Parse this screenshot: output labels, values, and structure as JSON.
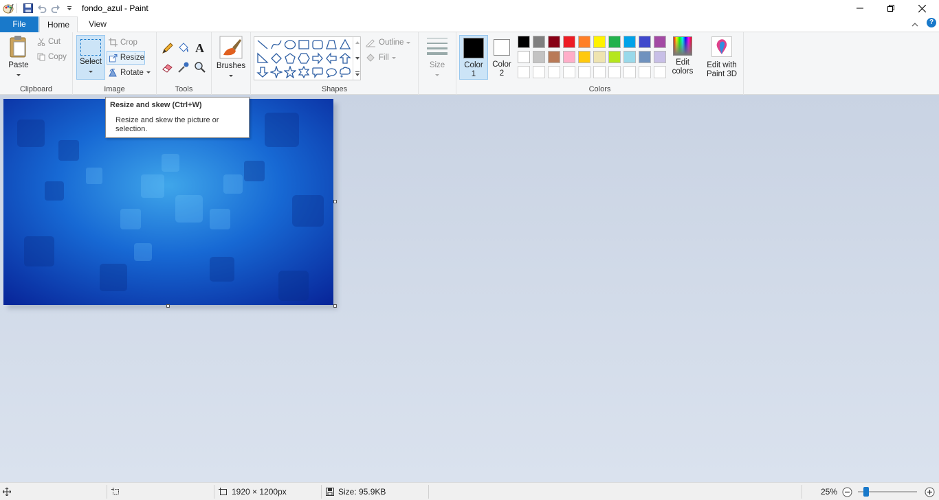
{
  "window": {
    "title": "fondo_azul - Paint"
  },
  "tabs": [
    {
      "label": "File"
    },
    {
      "label": "Home"
    },
    {
      "label": "View"
    }
  ],
  "clipboard": {
    "paste": "Paste",
    "cut": "Cut",
    "copy": "Copy",
    "group": "Clipboard"
  },
  "image": {
    "select": "Select",
    "crop": "Crop",
    "resize": "Resize",
    "rotate": "Rotate",
    "group": "Image"
  },
  "tools": {
    "group": "Tools"
  },
  "brushes": {
    "label": "Brushes"
  },
  "shapes": {
    "outline": "Outline",
    "fill": "Fill",
    "group": "Shapes"
  },
  "size": {
    "label": "Size"
  },
  "colors": {
    "color1": "Color",
    "color1_num": "1",
    "color2": "Color",
    "color2_num": "2",
    "edit_colors_1": "Edit",
    "edit_colors_2": "colors",
    "edit_paint3d_1": "Edit with",
    "edit_paint3d_2": "Paint 3D",
    "group": "Colors",
    "row1": [
      "#000000",
      "#7f7f7f",
      "#880015",
      "#ed1c24",
      "#ff7f27",
      "#fff200",
      "#22b14c",
      "#00a2e8",
      "#3f48cc",
      "#a349a4"
    ],
    "row2": [
      "#ffffff",
      "#c3c3c3",
      "#b97a57",
      "#ffaec9",
      "#ffc90e",
      "#efe4b0",
      "#b5e61d",
      "#99d9ea",
      "#7092be",
      "#c8bfe7"
    ],
    "row3": [
      "#ffffff",
      "#ffffff",
      "#ffffff",
      "#ffffff",
      "#ffffff",
      "#ffffff",
      "#ffffff",
      "#ffffff",
      "#ffffff",
      "#ffffff"
    ],
    "primary": "#000000",
    "secondary": "#ffffff"
  },
  "tooltip": {
    "title": "Resize and skew (Ctrl+W)",
    "body_1": "Resize and skew the picture or",
    "body_2": "selection."
  },
  "status": {
    "dimensions": "1920 × 1200px",
    "size": "Size: 95.9KB",
    "zoom": "25%"
  },
  "zoom_level_fraction": 0.25
}
